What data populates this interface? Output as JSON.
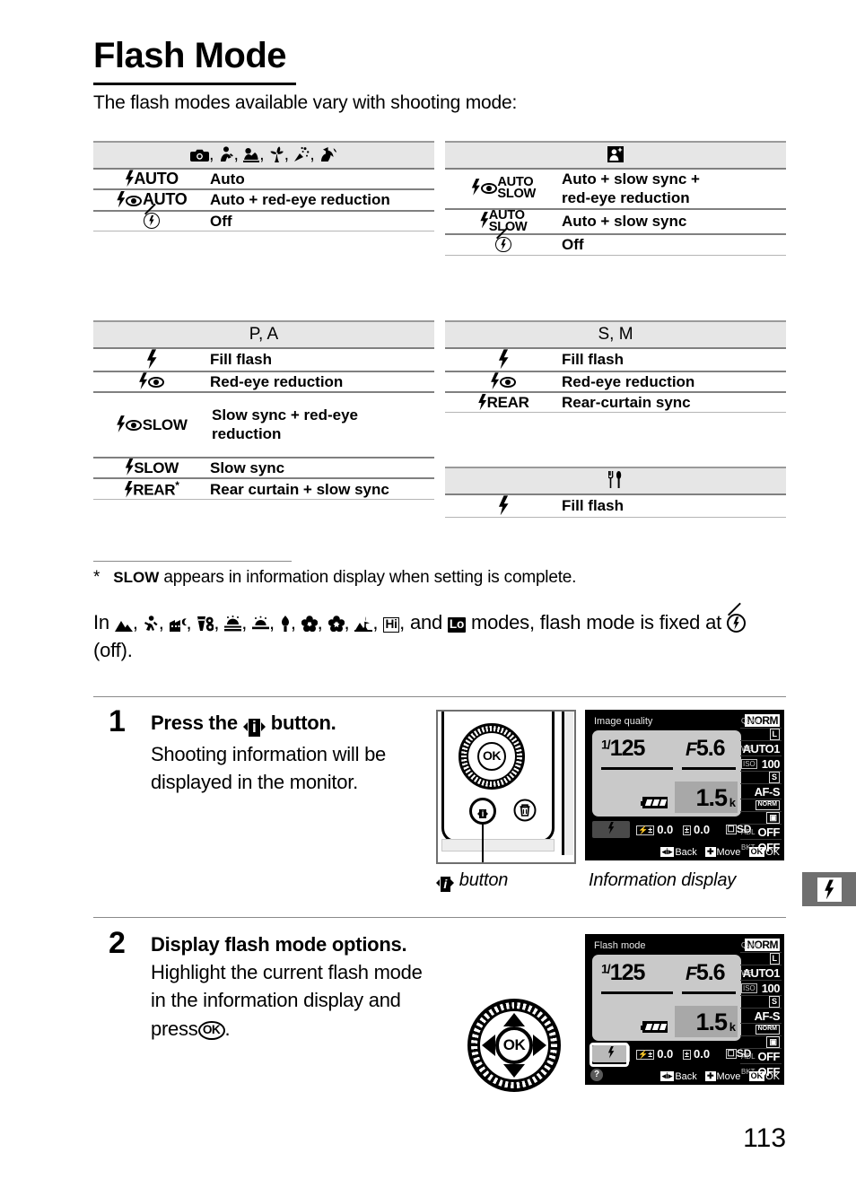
{
  "page": {
    "title": "Flash Mode",
    "intro": "The flash modes available vary with shooting mode:",
    "page_number": "113"
  },
  "tables": {
    "auto_modes": {
      "header_icons": "auto, portrait, landscape, close-up, party, pet-portrait",
      "rows": [
        {
          "icon": "flash-auto-icon",
          "label": "Auto"
        },
        {
          "icon": "flash-auto-redeye-icon",
          "label": "Auto + red-eye reduction"
        },
        {
          "icon": "flash-off-icon",
          "label": "Off"
        }
      ]
    },
    "night_portrait": {
      "header_icons": "night-portrait",
      "rows": [
        {
          "icon": "flash-auto-slow-redeye-icon",
          "label_line1": "Auto + slow sync +",
          "label_line2": "red-eye reduction"
        },
        {
          "icon": "flash-auto-slow-icon",
          "label_line1": "Auto + slow sync",
          "label_line2": ""
        },
        {
          "icon": "flash-off-icon",
          "label_line1": "Off",
          "label_line2": ""
        }
      ]
    },
    "p_a": {
      "header": "P, A",
      "rows": [
        {
          "icon": "flash-fill-icon",
          "label_line1": "Fill flash",
          "label_line2": ""
        },
        {
          "icon": "flash-redeye-icon",
          "label_line1": "Red-eye reduction",
          "label_line2": ""
        },
        {
          "icon": "flash-slow-redeye-icon",
          "label_line1": "Slow sync + red-eye",
          "label_line2": "reduction"
        },
        {
          "icon": "flash-slow-icon",
          "label_line1": "Slow sync",
          "label_line2": ""
        },
        {
          "icon": "flash-rear-icon",
          "label_line1": "Rear curtain + slow sync",
          "label_line2": "",
          "footnote_marker": "*"
        }
      ]
    },
    "s_m": {
      "header": "S, M",
      "rows": [
        {
          "icon": "flash-fill-icon",
          "label": "Fill flash"
        },
        {
          "icon": "flash-redeye-icon",
          "label": "Red-eye reduction"
        },
        {
          "icon": "flash-rear-icon",
          "label": "Rear-curtain sync"
        }
      ]
    },
    "food": {
      "header_icons": "food",
      "rows": [
        {
          "icon": "flash-fill-icon",
          "label": "Fill flash"
        }
      ]
    }
  },
  "footnote": {
    "marker": "*",
    "keyword": "SLOW",
    "text": "appears in information display when setting is complete."
  },
  "modes_paragraph": {
    "prefix": "In",
    "suffix": "modes, flash mode is fixed at",
    "tail": "(off).",
    "icon_labels": [
      "landscape",
      "child",
      "sports",
      "night-landscape",
      "beach-snow",
      "sunset",
      "dusk-dawn",
      "candlelight",
      "blossom",
      "autumn-colors",
      "silhouette",
      "high-key",
      "low-key"
    ],
    "hi_label": "Hi",
    "lo_label": "Lo"
  },
  "steps": [
    {
      "number": "1",
      "heading_before": "Press the",
      "heading_after": "button.",
      "body": "Shooting information will be displayed in the monitor.",
      "caption_left": "button",
      "caption_right": "Information display"
    },
    {
      "number": "2",
      "heading": "Display flash mode options.",
      "body_before": "Highlight the current flash mode in the information display and press",
      "body_after": "."
    }
  ],
  "lcd": {
    "title_step1": "Image quality",
    "title_step2": "Flash mode",
    "shutter_frac": "1/",
    "shutter": "125",
    "aperture_f": "F",
    "aperture": "5.6",
    "shots_remaining": "1.5",
    "shots_unit": "k",
    "bottom_row": {
      "flash_icon": "flash-icon",
      "flash_comp_tag": "flash-comp-icon",
      "flash_comp_value": "0.0",
      "exp_comp_tag": "exposure-comp-icon",
      "exp_comp_value": "0.0",
      "card_tag": "card-icon",
      "card_value": "SD"
    },
    "status_bar": {
      "back_key": "i",
      "back_label": "Back",
      "move_key": "multi-selector",
      "move_label": "Move",
      "ok_key": "OK",
      "ok_label": "OK"
    },
    "help": "?",
    "side_panel": [
      {
        "label": "QUAL",
        "value": "NORM",
        "sub": "L"
      },
      {
        "label": "WB",
        "value": "AUTO1"
      },
      {
        "label": "ISO",
        "value": "100"
      },
      {
        "label": "",
        "value": "S"
      },
      {
        "label": "",
        "value": "AF-S"
      },
      {
        "label": "",
        "value": "NORM"
      },
      {
        "label": "",
        "value": "matrix-metering-icon"
      },
      {
        "label": "ADL",
        "value": "OFF"
      },
      {
        "label": "BKT",
        "value": "OFF"
      }
    ]
  },
  "camera_figure": {
    "ok_label": "OK",
    "i_button": "i",
    "delete_icon": "trash-icon"
  },
  "side_tab": {
    "icon": "flash-icon"
  },
  "colors": {
    "header_bg": "#e6e6e6",
    "rule": "#808080",
    "lcd_bg": "#000000",
    "lcd_panel": "#c9c9c9",
    "side_tab": "#6f6f6f"
  }
}
